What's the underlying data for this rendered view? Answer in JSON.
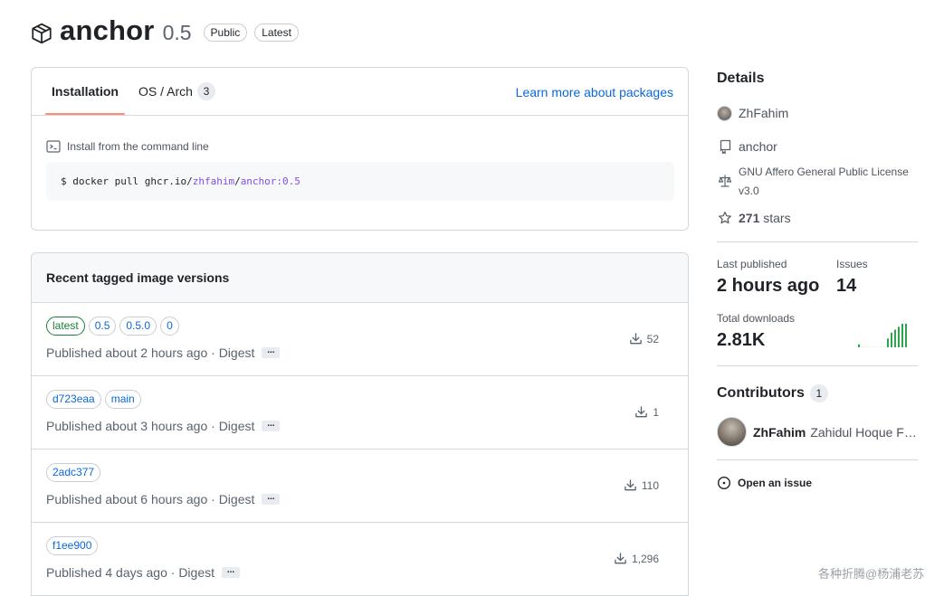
{
  "package": {
    "name": "anchor",
    "version": "0.5",
    "labels": [
      "Public",
      "Latest"
    ]
  },
  "tabs": {
    "installation": "Installation",
    "os_arch": "OS / Arch",
    "os_arch_count": "3",
    "learn_more": "Learn more about packages"
  },
  "install": {
    "label": "Install from the command line",
    "cmd_prefix": "$ docker pull ghcr.io/",
    "cmd_owner": "zhfahim",
    "cmd_sep": "/",
    "cmd_image": "anchor:0.5"
  },
  "versions": {
    "title": "Recent tagged image versions",
    "rows": [
      {
        "tags": [
          "latest",
          "0.5",
          "0.5.0",
          "0"
        ],
        "published": "Published about 2 hours ago · Digest",
        "downloads": "52"
      },
      {
        "tags": [
          "d723eaa",
          "main"
        ],
        "published": "Published about 3 hours ago · Digest",
        "downloads": "1"
      },
      {
        "tags": [
          "2adc377"
        ],
        "published": "Published about 6 hours ago · Digest",
        "downloads": "110"
      },
      {
        "tags": [
          "f1ee900"
        ],
        "published": "Published 4 days ago · Digest",
        "downloads": "1,296"
      }
    ],
    "digest_button": "..."
  },
  "details": {
    "title": "Details",
    "owner": "ZhFahim",
    "repo": "anchor",
    "license": "GNU Affero General Public License v3.0",
    "stars_count": "271",
    "stars_suffix": " stars"
  },
  "stats": {
    "last_published_label": "Last published",
    "last_published_value": "2 hours ago",
    "issues_label": "Issues",
    "issues_value": "14",
    "total_downloads_label": "Total downloads",
    "total_downloads_value": "2.81K"
  },
  "chart_data": {
    "type": "bar",
    "values": [
      1,
      0,
      0,
      0,
      0,
      0,
      0,
      0,
      3,
      5,
      6,
      7,
      8,
      8
    ]
  },
  "contributors": {
    "title": "Contributors",
    "count": "1",
    "list": [
      {
        "login": "ZhFahim",
        "name": "Zahidul Hoque Fahim"
      }
    ]
  },
  "actions": {
    "open_issue": "Open an issue"
  },
  "watermark": "各种折腾@杨浦老苏",
  "colors": {
    "link": "#0969da",
    "accent_underline": "#fd8c73",
    "latest_tag": "#1a7f37",
    "spark": "#2da44e",
    "code_highlight": "#8250df"
  }
}
